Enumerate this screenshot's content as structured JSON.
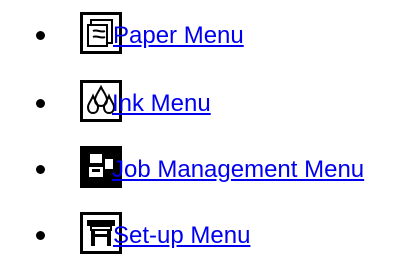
{
  "menu": {
    "link_color": "#0000ee",
    "items": [
      {
        "label": "Paper Menu",
        "icon": "paper-stack-icon"
      },
      {
        "label": "Ink Menu",
        "icon": "ink-drops-icon"
      },
      {
        "label": "Job Management Menu",
        "icon": "job-management-icon"
      },
      {
        "label": "Set-up Menu",
        "icon": "printer-setup-icon"
      }
    ]
  }
}
